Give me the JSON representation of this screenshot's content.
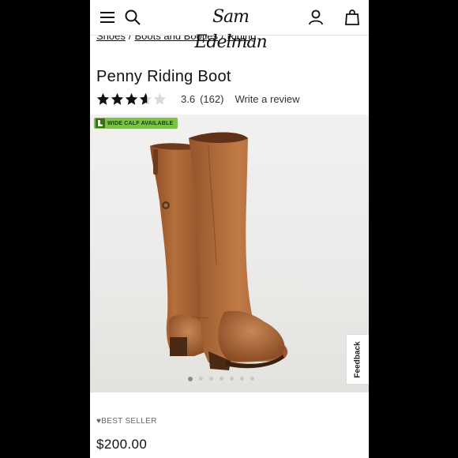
{
  "header": {
    "logo_text": "Sam Edelman",
    "icons": [
      "menu-icon",
      "search-icon",
      "account-icon",
      "bag-icon"
    ]
  },
  "breadcrumb": {
    "items": [
      "Shoes",
      "Boots and Booties",
      "Riding"
    ],
    "separator": "/"
  },
  "product": {
    "title": "Penny Riding Boot",
    "rating": 3.6,
    "rating_text": "3.6",
    "review_count_text": "(162)",
    "write_review_label": "Write a review",
    "badge_label": "WIDE CALF AVAILABLE",
    "best_seller_label": "BEST SELLER",
    "price": "$200.00"
  },
  "gallery": {
    "image_count": 7,
    "active_index": 0
  },
  "feedback_tab": {
    "label": "Feedback"
  },
  "colors": {
    "badge_green": "#7cc24a",
    "star_fill": "#111111",
    "star_empty": "#d9d9d9",
    "boot_leather": "#a86335"
  }
}
